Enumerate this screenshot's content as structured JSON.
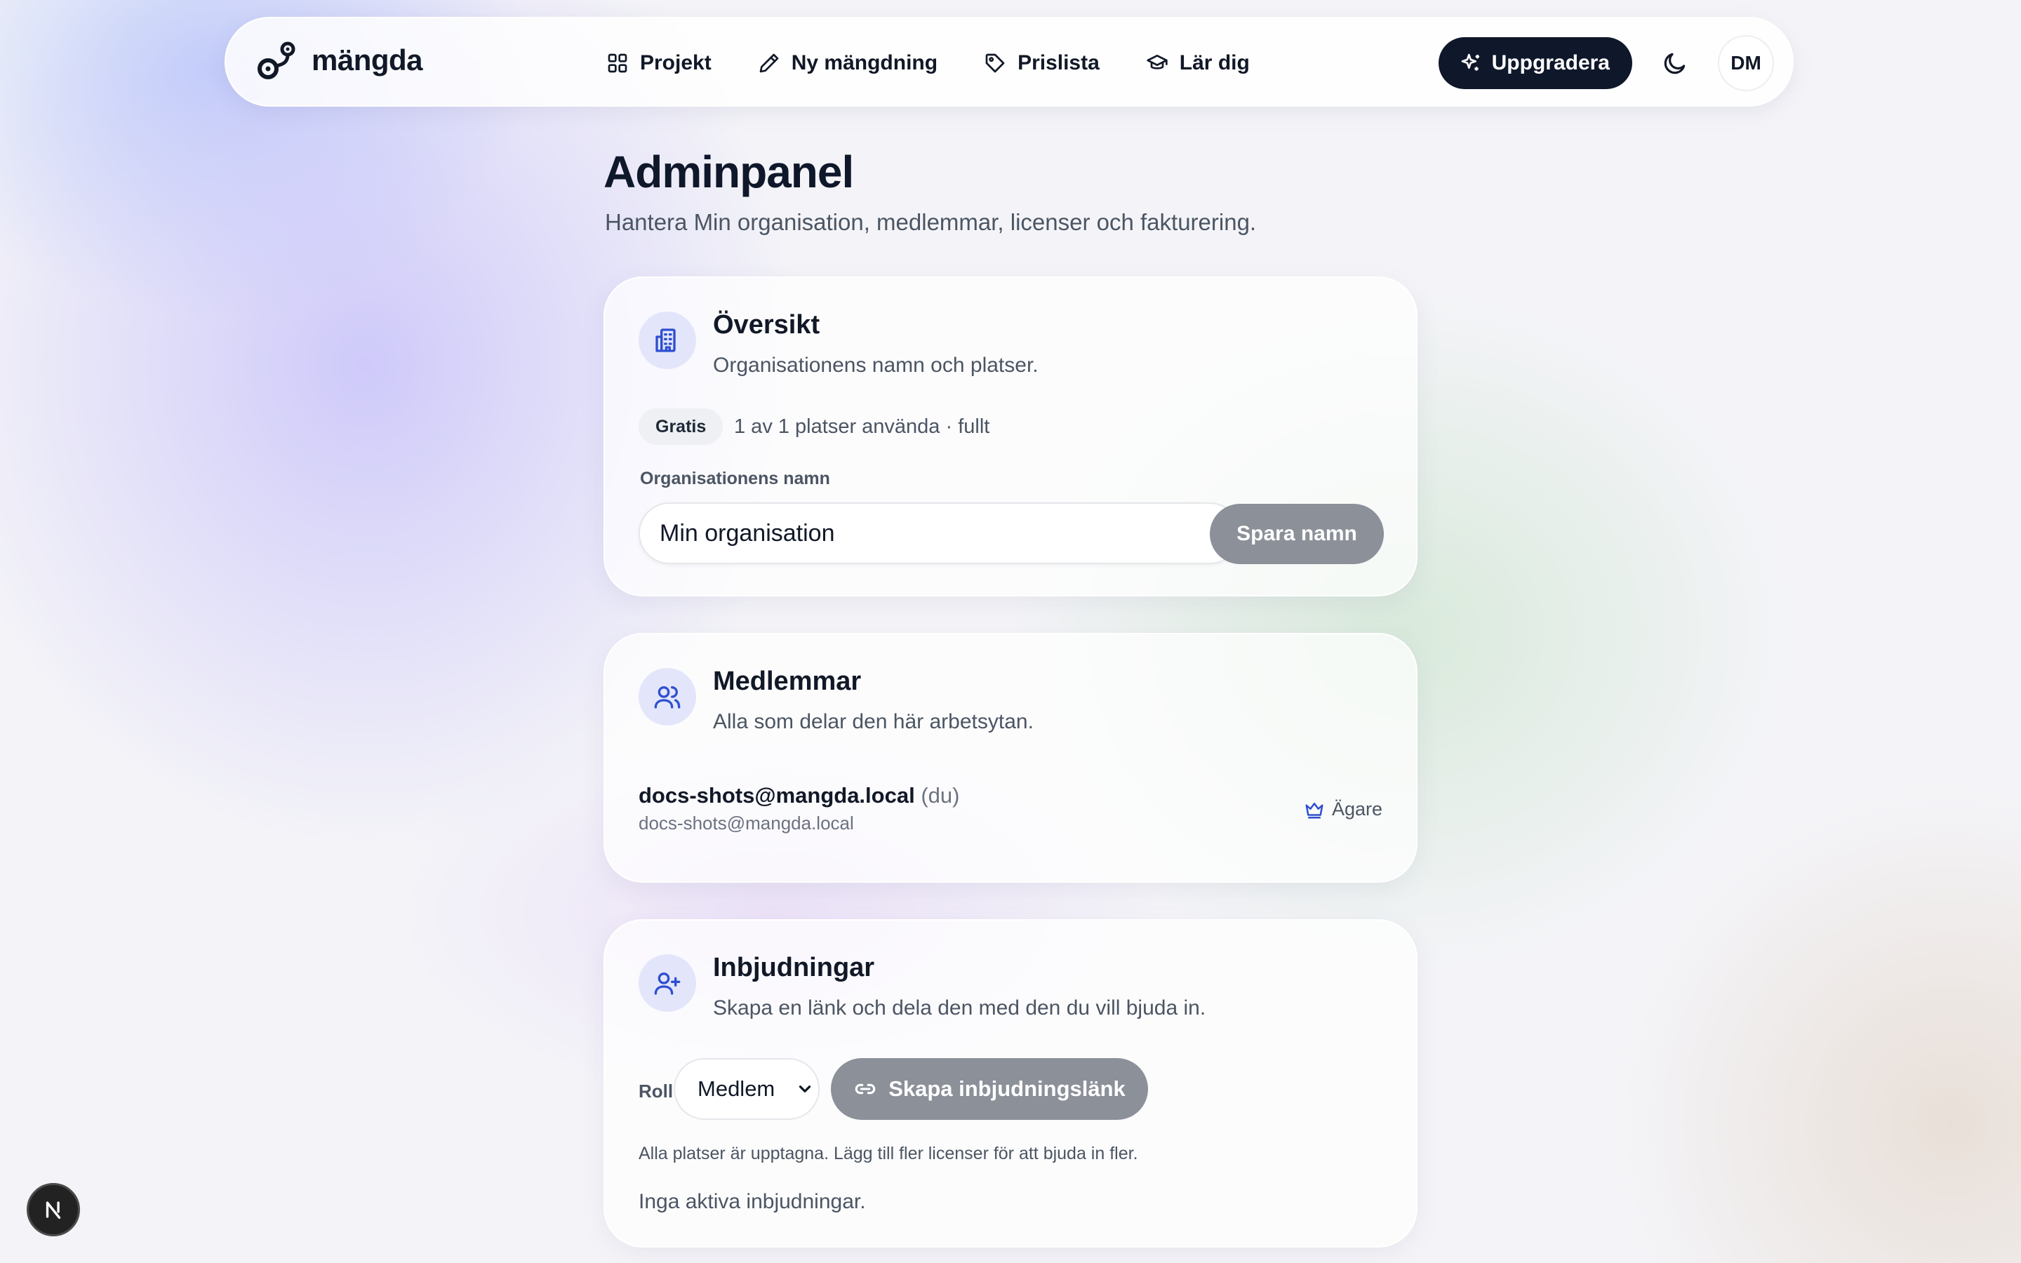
{
  "brand": {
    "name": "mängda"
  },
  "nav": {
    "items": [
      {
        "label": "Projekt",
        "icon": "grid-icon"
      },
      {
        "label": "Ny mängdning",
        "icon": "pencil-icon"
      },
      {
        "label": "Prislista",
        "icon": "tag-icon"
      },
      {
        "label": "Lär dig",
        "icon": "graduation-cap-icon"
      }
    ],
    "upgrade_label": "Uppgradera",
    "avatar_initials": "DM"
  },
  "page": {
    "title": "Adminpanel",
    "subtitle": "Hantera Min organisation, medlemmar, licenser och fakturering."
  },
  "overview": {
    "title": "Översikt",
    "description": "Organisationens namn och platser.",
    "plan_badge": "Gratis",
    "seats_text": "1 av 1 platser använda · fullt",
    "name_label": "Organisationens namn",
    "name_value": "Min organisation",
    "save_label": "Spara namn"
  },
  "members": {
    "title": "Medlemmar",
    "description": "Alla som delar den här arbetsytan.",
    "list": [
      {
        "email": "docs-shots@mangda.local",
        "you_label": "(du)",
        "sub": "docs-shots@mangda.local",
        "role": "Ägare"
      }
    ]
  },
  "invites": {
    "title": "Inbjudningar",
    "description": "Skapa en länk och dela den med den du vill bjuda in.",
    "role_label": "Roll",
    "role_value": "Medlem",
    "create_label": "Skapa inbjudningslänk",
    "seats_full_text": "Alla platser är upptagna. Lägg till fler licenser för att bjuda in fler.",
    "empty_text": "Inga aktiva inbjudningar."
  },
  "fab": {
    "label": "N"
  },
  "colors": {
    "primary_dark": "#0f172a",
    "accent_blue": "#2f4fd0",
    "icon_bg": "#e3e6fb",
    "disabled_button": "#8b9099"
  }
}
